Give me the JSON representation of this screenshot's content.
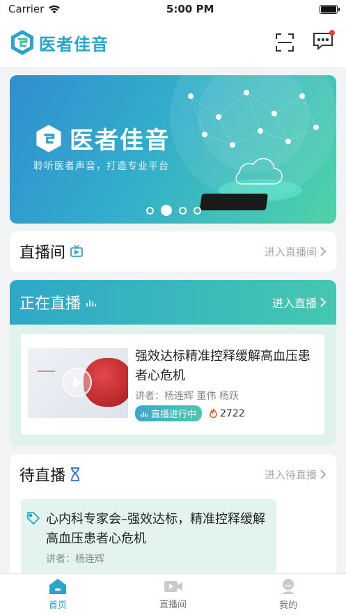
{
  "status": {
    "carrier": "Carrier",
    "time": "5:00 PM"
  },
  "header": {
    "app_name": "医者佳音"
  },
  "banner": {
    "brand": "医者佳音",
    "slogan": "聆听医者声音，打造专业平台",
    "slide_count": 4,
    "active_slide": 2
  },
  "live_room": {
    "title": "直播间",
    "enter": "进入直播间"
  },
  "now_live": {
    "title": "正在直播",
    "enter": "进入直播",
    "item": {
      "title": "强效达标精准控释缓解高血压患者心危机",
      "speakers": "讲者：杨连辉 董伟 杨跃",
      "status": "直播进行中",
      "views": "2722"
    }
  },
  "upcoming": {
    "title": "待直播",
    "enter": "进入待直播",
    "item": {
      "title": "心内科专家会–强效达标，精准控释缓解高血压患者心危机",
      "speaker": "讲者：杨连辉"
    }
  },
  "tabs": [
    {
      "label": "首页",
      "icon": "home-icon"
    },
    {
      "label": "直播间",
      "icon": "video-icon"
    },
    {
      "label": "我的",
      "icon": "profile-icon"
    }
  ],
  "colors": {
    "primary": "#2aa4c8",
    "accent": "#4dc9a9"
  }
}
